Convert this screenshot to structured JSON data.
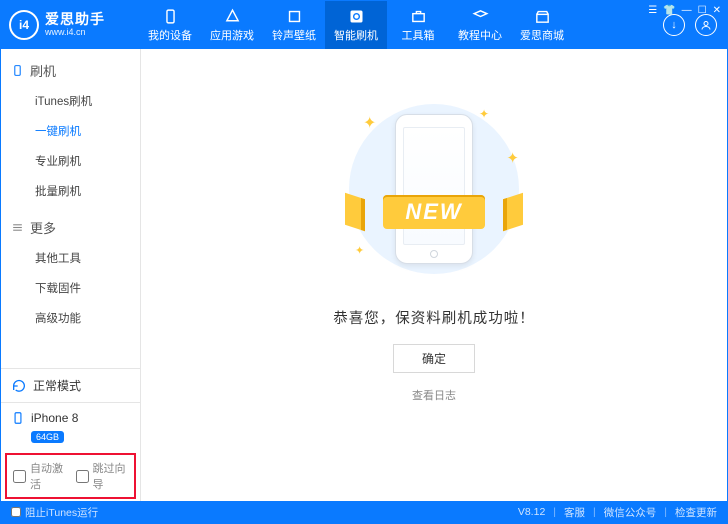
{
  "brand": {
    "logo": "i4",
    "title": "爱思助手",
    "url": "www.i4.cn"
  },
  "tabs": [
    {
      "label": "我的设备"
    },
    {
      "label": "应用游戏"
    },
    {
      "label": "铃声壁纸"
    },
    {
      "label": "智能刷机"
    },
    {
      "label": "工具箱"
    },
    {
      "label": "教程中心"
    },
    {
      "label": "爱思商城"
    }
  ],
  "sidebar": {
    "section1": {
      "title": "刷机",
      "items": [
        "iTunes刷机",
        "一键刷机",
        "专业刷机",
        "批量刷机"
      ]
    },
    "section2": {
      "title": "更多",
      "items": [
        "其他工具",
        "下载固件",
        "高级功能"
      ]
    }
  },
  "mode": {
    "label": "正常模式"
  },
  "device": {
    "name": "iPhone 8",
    "badge": "64GB"
  },
  "checks": {
    "auto_activate": "自动激活",
    "skip_guide": "跳过向导"
  },
  "main": {
    "ribbon": "NEW",
    "success": "恭喜您，保资料刷机成功啦！",
    "ok": "确定",
    "log": "查看日志"
  },
  "footer": {
    "block_itunes": "阻止iTunes运行",
    "version": "V8.12",
    "support": "客服",
    "wechat": "微信公众号",
    "update": "检查更新"
  }
}
